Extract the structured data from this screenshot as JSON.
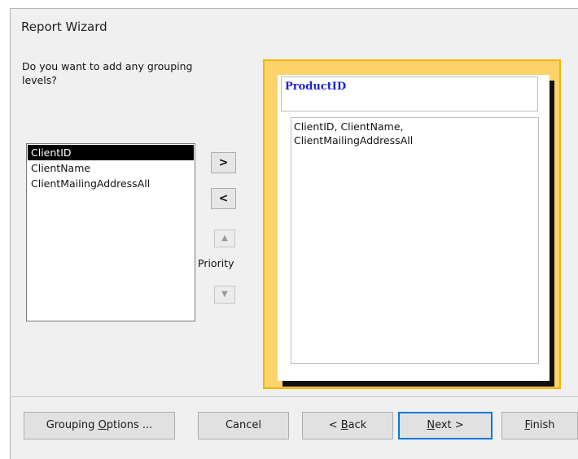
{
  "window": {
    "title": "Report Wizard"
  },
  "prompt": "Do you want to add any grouping levels?",
  "fields_list": [
    {
      "label": "ClientID",
      "selected": true
    },
    {
      "label": "ClientName",
      "selected": false
    },
    {
      "label": "ClientMailingAddressAll",
      "selected": false
    }
  ],
  "buttons": {
    "add": ">",
    "remove": "<",
    "priority_up": "▲",
    "priority_down": "▼",
    "priority_label": "Priority"
  },
  "preview": {
    "group_level": "ProductID",
    "detail_fields": "ClientID, ClientName, ClientMailingAddressAll"
  },
  "footer": {
    "grouping_options": {
      "pre": "Grouping ",
      "key": "O",
      "post": "ptions ..."
    },
    "cancel": "Cancel",
    "back": {
      "pre": "< ",
      "key": "B",
      "post": "ack"
    },
    "next": {
      "pre": "",
      "key": "N",
      "post": "ext >"
    },
    "finish": {
      "pre": "",
      "key": "F",
      "post": "inish"
    }
  }
}
